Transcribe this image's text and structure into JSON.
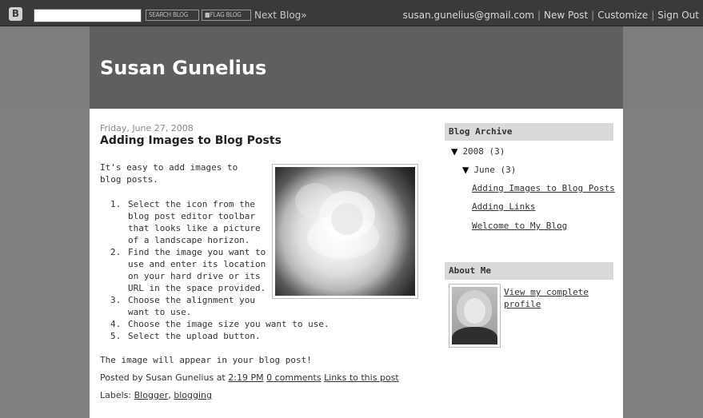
{
  "navbar": {
    "logo": "B",
    "search_label": "SEARCH BLOG",
    "flag_label": "■FLAG BLOG",
    "next_blog": "Next Blog»",
    "email": "susan.gunelius@gmail.com",
    "new_post": "New Post",
    "customize": "Customize",
    "sign_out": "Sign Out"
  },
  "header": {
    "title": "Susan Gunelius"
  },
  "post": {
    "date": "Friday, June 27, 2008",
    "title": "Adding Images to Blog Posts",
    "intro": "It's easy to add images to blog posts.",
    "steps": [
      "Select the icon from the blog post editor toolbar that looks like a picture of a landscape horizon.",
      "Find the image you want to use and enter its location on your hard drive or its URL in the space provided.",
      "Choose the alignment you want to use.",
      "Choose the image size you want to use.",
      "Select the upload button."
    ],
    "closing": "The image will appear in your blog post!",
    "posted_by": "Posted by Susan Gunelius at",
    "time": "2:19 PM",
    "comments": "0 comments",
    "links": "Links to this post",
    "labels_prefix": "Labels:",
    "labels": [
      "Blogger",
      "blogging"
    ]
  },
  "sidebar": {
    "archive_title": "Blog Archive",
    "year": "2008 (3)",
    "month": "June (3)",
    "posts": [
      "Adding Images to Blog Posts",
      "Adding Links",
      "Welcome to My Blog"
    ],
    "about_title": "About Me",
    "profile_link": "View my complete profile"
  }
}
